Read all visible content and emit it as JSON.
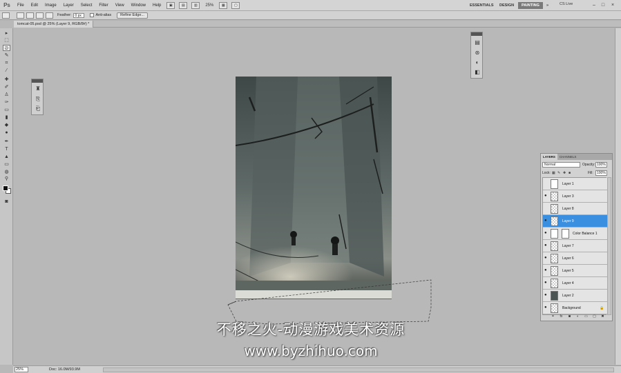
{
  "app": {
    "logo": "Ps",
    "menu": [
      "File",
      "Edit",
      "Image",
      "Layer",
      "Select",
      "Filter",
      "View",
      "Window",
      "Help"
    ],
    "zoom": "25%",
    "workspaces": [
      "ESSENTIALS",
      "DESIGN",
      "PAINTING"
    ],
    "active_workspace": "PAINTING",
    "cs_live": "CS Live"
  },
  "options_bar": {
    "feather_label": "Feather:",
    "feather_value": "0 px",
    "antialias_label": "Anti-alias",
    "refine_edge": "Refine Edge..."
  },
  "document": {
    "tab_title": "tomcat-05.psd @ 25% (Layer 9, RGB/8#) *",
    "status_zoom": "25%",
    "status_doc": "Doc: 16.0M/93.9M"
  },
  "layers_panel": {
    "tabs": [
      "LAYERS",
      "CHANNELS"
    ],
    "blend_mode": "Normal",
    "opacity_label": "Opacity:",
    "opacity": "100%",
    "lock_label": "Lock:",
    "fill_label": "Fill:",
    "fill": "100%",
    "layers": [
      {
        "name": "Layer 1",
        "visible": false,
        "thumb": "light"
      },
      {
        "name": "Layer 3",
        "visible": true,
        "thumb": "checker"
      },
      {
        "name": "Layer 8",
        "visible": false,
        "thumb": "checker"
      },
      {
        "name": "Layer 9",
        "visible": true,
        "thumb": "checker",
        "selected": true
      },
      {
        "name": "Color Balance 1",
        "visible": true,
        "thumb": "adjustment"
      },
      {
        "name": "Layer 7",
        "visible": true,
        "thumb": "checker"
      },
      {
        "name": "Layer 6",
        "visible": true,
        "thumb": "checker"
      },
      {
        "name": "Layer 5",
        "visible": true,
        "thumb": "checker"
      },
      {
        "name": "Layer 4",
        "visible": true,
        "thumb": "checker"
      },
      {
        "name": "Layer 2",
        "visible": true,
        "thumb": "dark"
      },
      {
        "name": "Background",
        "visible": true,
        "thumb": "checker"
      }
    ]
  },
  "watermark": {
    "line1": "不移之火-动漫游戏美术资源",
    "line2": "www.byzhihuo.com"
  },
  "colors": {
    "selected_layer": "#3b8fe0",
    "active_workspace": "#7a7a7a"
  }
}
